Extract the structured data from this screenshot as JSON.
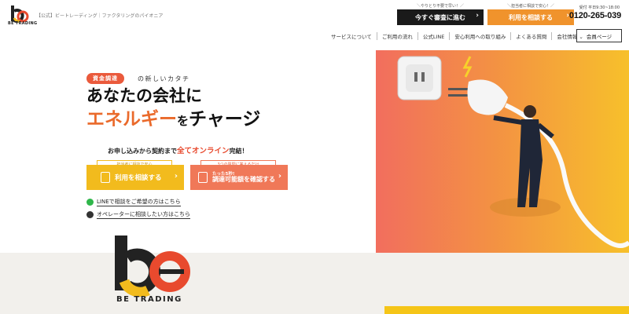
{
  "header": {
    "logo_text": "BE TRADING",
    "site_description": "【公式】ビートレーディング｜ファクタリングのパイオニア",
    "cta_primary_note": "＼やりとり不要で早い！／",
    "cta_primary_label": "今すぐ審査に進む",
    "cta_secondary_note": "＼担当者に相談で安心！／",
    "cta_secondary_label": "利用を相談する",
    "hours": "受付 平日9:30~18:00",
    "phone": "0120-265-039"
  },
  "nav": {
    "items": [
      "サービスについて",
      "ご利用の流れ",
      "公式LINE",
      "安心利用への取り組み",
      "よくある質問",
      "会社情報 ⌄"
    ],
    "member_label": "会員ページ"
  },
  "hero": {
    "tag": "資金調達",
    "tag_suffix": "の新しいカタチ",
    "headline1": "あなたの会社に",
    "headline2_accent": "エネルギー",
    "headline2_small": "を",
    "headline2_rest": "チャージ",
    "lead_pre": "お申し込みから契約まで",
    "lead_em": "全てオンライン",
    "lead_post": "完結！",
    "btn1_bubble": "担当者に相談で安心",
    "btn1_label": "利用を相談する",
    "btn2_bubble": "3つの質問に答えるだけ",
    "btn2_sub": "たった5秒!",
    "btn2_label": "調達可能額を確認する",
    "link_line": "LINEで相談をご希望の方はこちら",
    "link_operator": "オペレーターに相談したい方はこちら"
  },
  "footer_logo_text": "BE TRADING",
  "colors": {
    "accent_orange": "#f0932c",
    "accent_red": "#ea5a3c",
    "accent_yellow": "#f2bb1d",
    "line_green": "#2fb64a"
  }
}
